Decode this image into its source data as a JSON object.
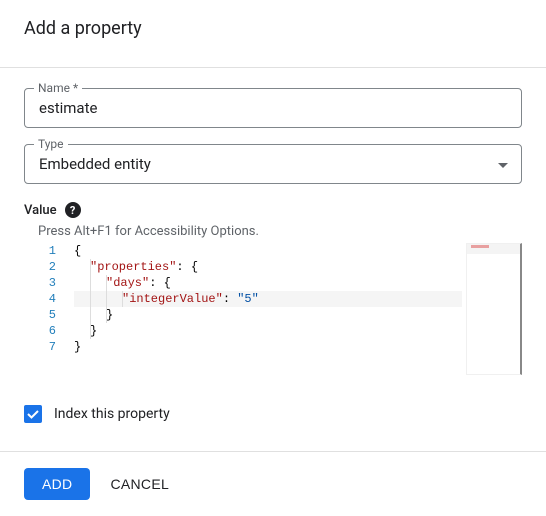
{
  "dialog": {
    "title": "Add a property",
    "name_label": "Name *",
    "name_value": "estimate",
    "type_label": "Type",
    "type_value": "Embedded entity",
    "value_label": "Value",
    "hint": "Press Alt+F1 for Accessibility Options.",
    "index_label": "Index this property",
    "index_checked": true
  },
  "code": {
    "lines": [
      {
        "num": "1",
        "indent": 0,
        "tokens": [
          {
            "t": "p",
            "v": "{"
          }
        ]
      },
      {
        "num": "2",
        "indent": 1,
        "tokens": [
          {
            "t": "s",
            "v": "\"properties\""
          },
          {
            "t": "p",
            "v": ": {"
          }
        ]
      },
      {
        "num": "3",
        "indent": 2,
        "tokens": [
          {
            "t": "s",
            "v": "\"days\""
          },
          {
            "t": "p",
            "v": ": {"
          }
        ]
      },
      {
        "num": "4",
        "indent": 3,
        "tokens": [
          {
            "t": "s",
            "v": "\"integerValue\""
          },
          {
            "t": "p",
            "v": ": "
          },
          {
            "t": "v",
            "v": "\"5\""
          }
        ]
      },
      {
        "num": "5",
        "indent": 2,
        "tokens": [
          {
            "t": "p",
            "v": "}"
          }
        ]
      },
      {
        "num": "6",
        "indent": 1,
        "tokens": [
          {
            "t": "p",
            "v": "}"
          }
        ]
      },
      {
        "num": "7",
        "indent": 0,
        "tokens": [
          {
            "t": "p",
            "v": "}"
          }
        ]
      }
    ],
    "current_line": 4
  },
  "buttons": {
    "add": "ADD",
    "cancel": "CANCEL"
  }
}
